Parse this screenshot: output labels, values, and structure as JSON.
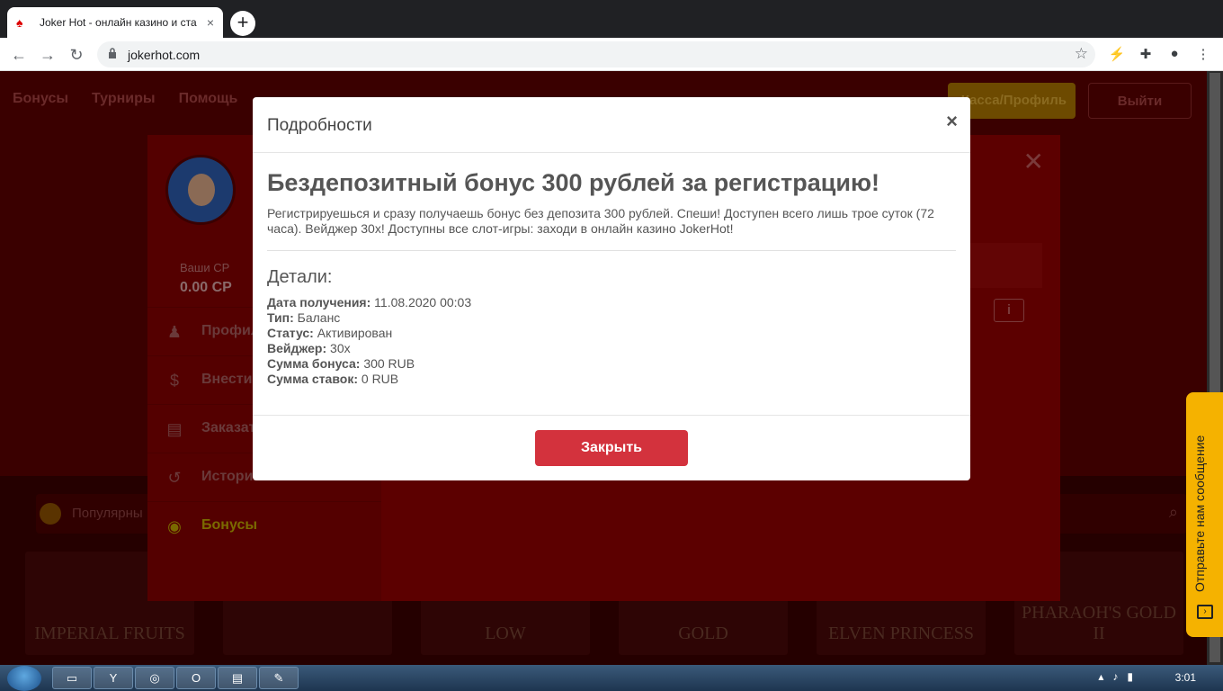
{
  "browser": {
    "tab_title": "Joker Hot - онлайн казино и ста",
    "tab_close": "×",
    "new_tab": "+",
    "url": "jokerhot.com"
  },
  "site": {
    "nav": [
      "Бонусы",
      "Турниры",
      "Помощь"
    ],
    "cashier_button": "Касса/Профиль",
    "logout_button": "Выйти",
    "popular_label": "Популярны",
    "game_tiles": [
      "IMPERIAL FRUITS",
      "",
      "LOW",
      "GOLD",
      "ELVEN PRINCESS",
      "PHARAOH'S GOLD II"
    ]
  },
  "profile": {
    "cp_label": "Ваши СР",
    "cp_value": "0.00 CP",
    "menu": [
      {
        "label": "Профиль",
        "icon": "user-icon"
      },
      {
        "label": "Внести",
        "icon": "deposit-icon"
      },
      {
        "label": "Заказать",
        "icon": "cashier-icon"
      },
      {
        "label": "История",
        "icon": "history-icon"
      },
      {
        "label": "Бонусы",
        "icon": "bonus-icon"
      }
    ],
    "close": "✕",
    "info": "i"
  },
  "modal": {
    "title": "Подробности",
    "close_x": "×",
    "bonus_title": "Бездепозитный бонус 300 рублей за регистрацию!",
    "bonus_description": "Регистрируешься и сразу получаешь бонус без депозита 300 рублей. Спеши! Доступен всего лишь трое суток (72 часа). Вейджер 30х! Доступны все слот-игры: заходи в онлайн казино JokerHot!",
    "details_title": "Детали:",
    "details": [
      {
        "label": "Дата получения:",
        "value": "11.08.2020 00:03"
      },
      {
        "label": "Тип:",
        "value": "Баланс"
      },
      {
        "label": "Статус:",
        "value": "Активирован"
      },
      {
        "label": "Вейджер:",
        "value": "30x"
      },
      {
        "label": "Сумма бонуса:",
        "value": "300 RUB"
      },
      {
        "label": "Сумма ставок:",
        "value": "0 RUB"
      }
    ],
    "close_button": "Закрыть"
  },
  "feedback": {
    "label": "Отправьте нам сообщение"
  },
  "taskbar": {
    "clock": "3:01"
  },
  "colors": {
    "accent": "#d3323d",
    "feedback": "#f5b200"
  }
}
